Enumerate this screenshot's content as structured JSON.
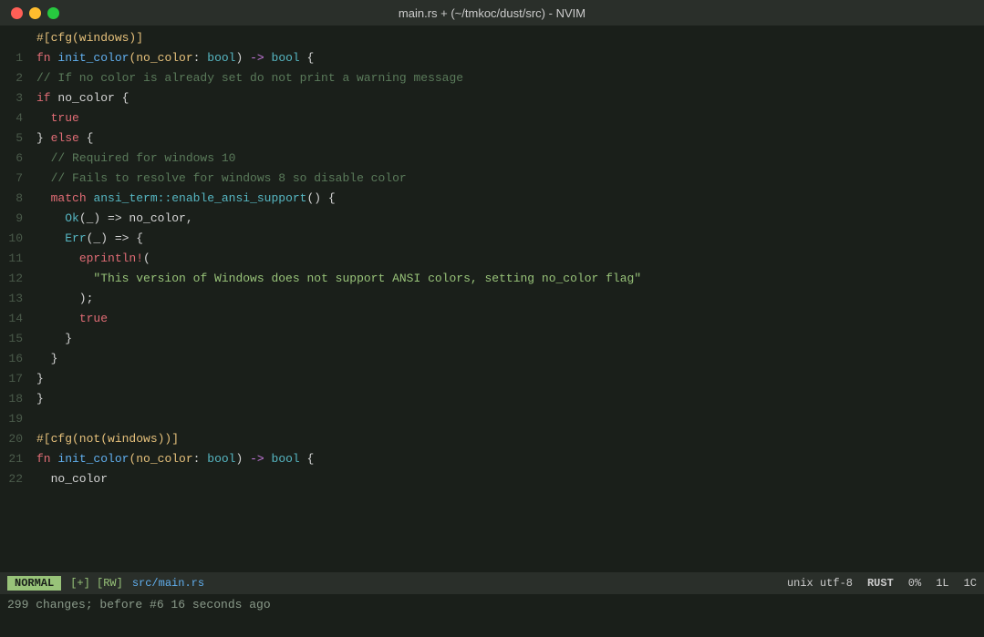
{
  "titlebar": {
    "title": "main.rs + (~/tmkoc/dust/src) - NVIM",
    "traffic_lights": [
      "close",
      "minimize",
      "maximize"
    ]
  },
  "editor": {
    "lines": [
      {
        "num": "",
        "tokens": [
          {
            "text": "#[cfg(windows)]",
            "class": "attr"
          }
        ]
      },
      {
        "num": "1",
        "tokens": [
          {
            "text": "fn ",
            "class": "kw"
          },
          {
            "text": "init_color",
            "class": "fn-name"
          },
          {
            "text": "(",
            "class": "paren"
          },
          {
            "text": "no_color",
            "class": "param"
          },
          {
            "text": ": ",
            "class": ""
          },
          {
            "text": "bool",
            "class": "type"
          },
          {
            "text": ") ",
            "class": ""
          },
          {
            "text": "->",
            "class": "arrow"
          },
          {
            "text": " ",
            "class": ""
          },
          {
            "text": "bool",
            "class": "type"
          },
          {
            "text": " {",
            "class": ""
          }
        ]
      },
      {
        "num": "2",
        "tokens": [
          {
            "text": "// If no color is already set do not print a warning message",
            "class": "comment"
          }
        ]
      },
      {
        "num": "3",
        "tokens": [
          {
            "text": "if",
            "class": "kw"
          },
          {
            "text": " no_color {",
            "class": ""
          }
        ]
      },
      {
        "num": "4",
        "tokens": [
          {
            "text": "true",
            "class": "kw"
          }
        ]
      },
      {
        "num": "5",
        "tokens": [
          {
            "text": "} ",
            "class": ""
          },
          {
            "text": "else",
            "class": "kw"
          },
          {
            "text": " {",
            "class": ""
          }
        ]
      },
      {
        "num": "6",
        "tokens": [
          {
            "text": "// Required for windows 10",
            "class": "comment"
          }
        ]
      },
      {
        "num": "7",
        "tokens": [
          {
            "text": "// Fails to resolve for windows 8 so disable color",
            "class": "comment"
          }
        ]
      },
      {
        "num": "8",
        "tokens": [
          {
            "text": "match",
            "class": "kw"
          },
          {
            "text": " ",
            "class": ""
          },
          {
            "text": "ansi_term::enable_ansi_support",
            "class": "path"
          },
          {
            "text": "() {",
            "class": ""
          }
        ]
      },
      {
        "num": "9",
        "tokens": [
          {
            "text": "Ok",
            "class": "ok-err"
          },
          {
            "text": "(_) => no_color,",
            "class": ""
          }
        ]
      },
      {
        "num": "10",
        "tokens": [
          {
            "text": "Err",
            "class": "ok-err"
          },
          {
            "text": "(_) => {",
            "class": ""
          }
        ]
      },
      {
        "num": "11",
        "tokens": [
          {
            "text": "eprintln!",
            "class": "macro"
          }
        ]
      },
      {
        "num": "12",
        "tokens": [
          {
            "text": "\"This version ",
            "class": "string"
          },
          {
            "text": "of",
            "class": "string"
          },
          {
            "text": " Windows does not support ANSI colors, setting no_color flag\"",
            "class": "string"
          }
        ]
      },
      {
        "num": "13",
        "tokens": [
          {
            "text": ");",
            "class": ""
          }
        ]
      },
      {
        "num": "14",
        "tokens": [
          {
            "text": "true",
            "class": "kw"
          }
        ]
      },
      {
        "num": "15",
        "tokens": [
          {
            "text": "}",
            "class": ""
          }
        ]
      },
      {
        "num": "16",
        "tokens": [
          {
            "text": "}",
            "class": ""
          }
        ]
      },
      {
        "num": "17",
        "tokens": [
          {
            "text": "}",
            "class": ""
          }
        ]
      },
      {
        "num": "18",
        "tokens": [
          {
            "text": "}",
            "class": ""
          }
        ]
      },
      {
        "num": "19",
        "tokens": []
      },
      {
        "num": "20",
        "tokens": [
          {
            "text": "#[cfg(not(windows))]",
            "class": "attr"
          }
        ]
      },
      {
        "num": "21",
        "tokens": [
          {
            "text": "fn ",
            "class": "kw"
          },
          {
            "text": "init_color",
            "class": "fn-name"
          },
          {
            "text": "(",
            "class": "paren"
          },
          {
            "text": "no_color",
            "class": "param"
          },
          {
            "text": ": ",
            "class": ""
          },
          {
            "text": "bool",
            "class": "type"
          },
          {
            "text": ") ",
            "class": ""
          },
          {
            "text": "->",
            "class": "arrow"
          },
          {
            "text": " ",
            "class": ""
          },
          {
            "text": "bool",
            "class": "type"
          },
          {
            "text": " {",
            "class": ""
          }
        ]
      },
      {
        "num": "22",
        "tokens": [
          {
            "text": "no_color",
            "class": ""
          }
        ]
      }
    ]
  },
  "statusbar": {
    "mode": "NORMAL",
    "flags": "[+] [RW]",
    "filename": "src/main.rs",
    "encoding": "unix utf-8",
    "filetype": "RUST",
    "percent": "0%",
    "line": "1L",
    "col": "1C"
  },
  "cmdline": {
    "text": "299 changes; before #6  16 seconds ago"
  }
}
